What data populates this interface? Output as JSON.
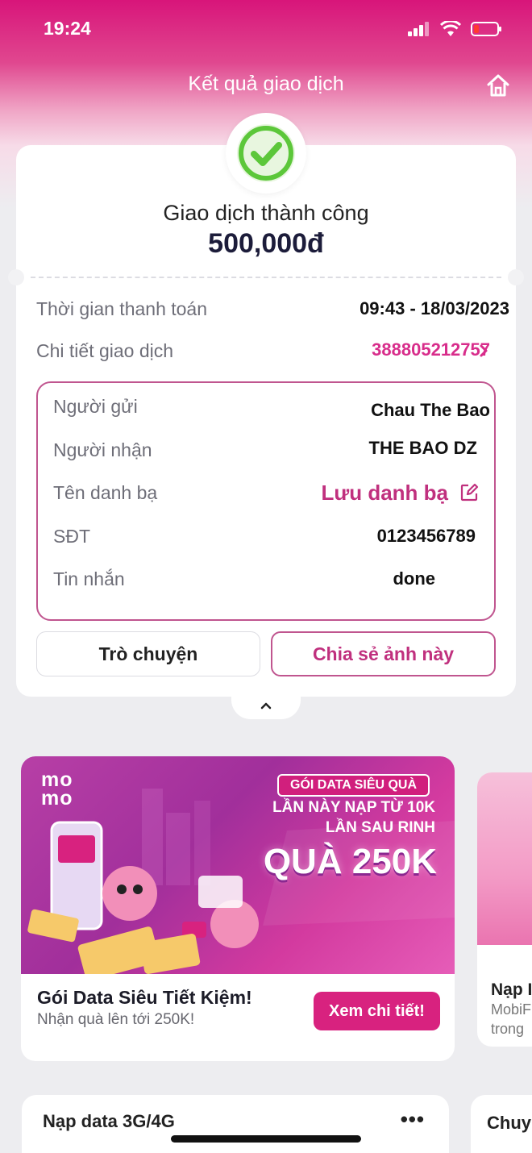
{
  "status_bar": {
    "time": "19:24"
  },
  "header": {
    "title": "Kết quả giao dịch"
  },
  "transaction": {
    "status": "Giao dịch thành công",
    "amount": "500,000đ",
    "time_label": "Thời gian thanh toán",
    "time_value": "09:43 - 18/03/2023",
    "detail_label": "Chi tiết giao dịch",
    "detail_value": "388805212757",
    "sender_label": "Người gửi",
    "sender_value": "Chau The Bao",
    "receiver_label": "Người nhận",
    "receiver_value": "THE BAO DZ",
    "contact_label": "Tên danh bạ",
    "contact_value": "Lưu danh bạ",
    "phone_label": "SĐT",
    "phone_value": "0123456789",
    "message_label": "Tin nhắn",
    "message_value": "done"
  },
  "actions": {
    "chat": "Trò chuyện",
    "share": "Chia sẻ ảnh này"
  },
  "promo": {
    "logo_line1": "mo",
    "logo_line2": "mo",
    "tag": "GÓI DATA SIÊU QUÀ",
    "line1": "LẦN NÀY NẠP TỪ 10K",
    "line2": "LẦN SAU RINH",
    "big": "QUÀ 250K",
    "title": "Gói Data Siêu Tiết Kiệm!",
    "subtitle": "Nhận quà lên tới 250K!",
    "button": "Xem chi tiết!"
  },
  "promo2": {
    "title": "Nạp I",
    "sub1": "MobiF",
    "sub2": "trong"
  },
  "bottom": {
    "title": "Nạp data 3G/4G",
    "more": "•••",
    "title2": "Chuy"
  },
  "colors": {
    "brand": "#d8227f",
    "accent_border": "#c0558f",
    "success": "#5cc73a"
  }
}
